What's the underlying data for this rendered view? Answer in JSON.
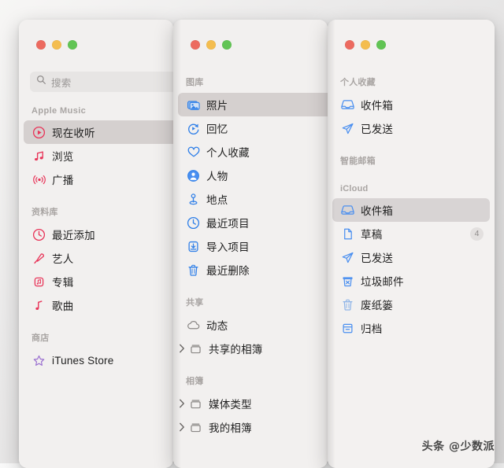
{
  "windows": [
    {
      "id": "music",
      "app": "music-app",
      "traffic": {
        "close": "close",
        "minimize": "minimize",
        "zoom": "zoom"
      },
      "search": {
        "placeholder": "搜索",
        "value": ""
      },
      "sections": [
        {
          "title": "Apple Music",
          "items": [
            {
              "label": "现在收听",
              "icon": "play-circle-icon",
              "selected": true
            },
            {
              "label": "浏览",
              "icon": "music-note-icon",
              "selected": false
            },
            {
              "label": "广播",
              "icon": "radio-waves-icon",
              "selected": false
            }
          ]
        },
        {
          "title": "资料库",
          "items": [
            {
              "label": "最近添加",
              "icon": "clock-icon",
              "selected": false
            },
            {
              "label": "艺人",
              "icon": "microphone-icon",
              "selected": false
            },
            {
              "label": "专辑",
              "icon": "album-icon",
              "selected": false
            },
            {
              "label": "歌曲",
              "icon": "single-note-icon",
              "selected": false
            }
          ]
        },
        {
          "title": "商店",
          "items": [
            {
              "label": "iTunes Store",
              "icon": "star-icon",
              "selected": false
            }
          ]
        }
      ]
    },
    {
      "id": "photos",
      "app": "photos-app",
      "traffic": {
        "close": "close",
        "minimize": "minimize",
        "zoom": "zoom"
      },
      "sections": [
        {
          "title": "图库",
          "items": [
            {
              "label": "照片",
              "icon": "photos-stack-icon",
              "selected": true
            },
            {
              "label": "回忆",
              "icon": "memories-icon",
              "selected": false
            },
            {
              "label": "个人收藏",
              "icon": "heart-icon",
              "selected": false
            },
            {
              "label": "人物",
              "icon": "person-circle-icon",
              "selected": false
            },
            {
              "label": "地点",
              "icon": "map-pin-icon",
              "selected": false
            },
            {
              "label": "最近项目",
              "icon": "clock-icon",
              "selected": false
            },
            {
              "label": "导入项目",
              "icon": "import-icon",
              "selected": false
            },
            {
              "label": "最近删除",
              "icon": "trash-icon",
              "selected": false
            }
          ]
        },
        {
          "title": "共享",
          "items": [
            {
              "label": "动态",
              "icon": "cloud-icon",
              "selected": false
            },
            {
              "label": "共享的相簿",
              "icon": "album-folder-icon",
              "selected": false,
              "chevron": true
            }
          ]
        },
        {
          "title": "相簿",
          "items": [
            {
              "label": "媒体类型",
              "icon": "album-folder-icon",
              "selected": false,
              "chevron": true
            },
            {
              "label": "我的相簿",
              "icon": "album-folder-icon",
              "selected": false,
              "chevron": true
            }
          ]
        }
      ]
    },
    {
      "id": "mail",
      "app": "mail-app",
      "traffic": {
        "close": "close",
        "minimize": "minimize",
        "zoom": "zoom"
      },
      "sections": [
        {
          "title": "个人收藏",
          "items": [
            {
              "label": "收件箱",
              "icon": "inbox-icon",
              "selected": false
            },
            {
              "label": "已发送",
              "icon": "paper-plane-icon",
              "selected": false
            }
          ]
        },
        {
          "title": "智能邮箱",
          "items": []
        },
        {
          "title": "iCloud",
          "items": [
            {
              "label": "收件箱",
              "icon": "inbox-icon",
              "selected": true
            },
            {
              "label": "草稿",
              "icon": "document-icon",
              "selected": false,
              "badge": "4"
            },
            {
              "label": "已发送",
              "icon": "paper-plane-icon",
              "selected": false
            },
            {
              "label": "垃圾邮件",
              "icon": "junk-icon",
              "selected": false
            },
            {
              "label": "废纸篓",
              "icon": "trash-icon",
              "selected": false
            },
            {
              "label": "归档",
              "icon": "archive-icon",
              "selected": false
            }
          ]
        }
      ]
    }
  ],
  "watermark": "头条 @少数派",
  "colors": {
    "accent_music": "#e8365a",
    "accent_photos": "#2f7fe8",
    "accent_mail": "#4a8ff0",
    "selected_bg": "#d5d0cf",
    "window_bg": "#f2f0ef",
    "traffic_close": "#ec6a5f",
    "traffic_minimize": "#f4bd4f",
    "traffic_zoom": "#61c454"
  }
}
